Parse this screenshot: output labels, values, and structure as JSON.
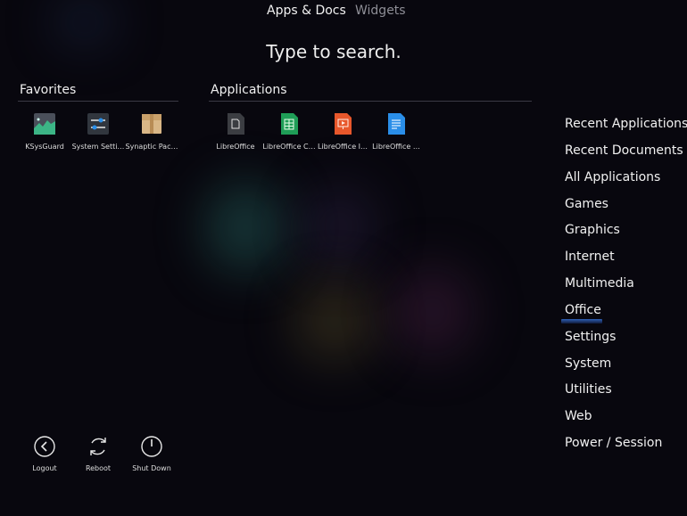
{
  "tabs": [
    {
      "label": "Apps & Docs",
      "active": true
    },
    {
      "label": "Widgets",
      "active": false
    }
  ],
  "search": {
    "hint": "Type to search."
  },
  "favorites": {
    "title": "Favorites",
    "items": [
      {
        "label": "KSysGuard",
        "icon": "ksysguard-icon"
      },
      {
        "label": "System Setti…",
        "icon": "system-settings-icon"
      },
      {
        "label": "Synaptic Pac…",
        "icon": "synaptic-package-icon"
      }
    ]
  },
  "applications": {
    "title": "Applications",
    "items": [
      {
        "label": "LibreOffice",
        "icon": "libreoffice-icon"
      },
      {
        "label": "LibreOffice C…",
        "icon": "libreoffice-calc-icon"
      },
      {
        "label": "LibreOffice I…",
        "icon": "libreoffice-impress-icon"
      },
      {
        "label": "LibreOffice …",
        "icon": "libreoffice-writer-icon"
      }
    ]
  },
  "categories": {
    "selected": "Office",
    "items": [
      "Recent Applications",
      "Recent Documents",
      "All Applications",
      "Games",
      "Graphics",
      "Internet",
      "Multimedia",
      "Office",
      "Settings",
      "System",
      "Utilities",
      "Web",
      "Power / Session"
    ]
  },
  "power": [
    {
      "label": "Logout",
      "icon": "logout-icon"
    },
    {
      "label": "Reboot",
      "icon": "reboot-icon"
    },
    {
      "label": "Shut Down",
      "icon": "shutdown-icon"
    }
  ],
  "colors": {
    "background": "#08070e",
    "selection_accent": "#2e5fb4",
    "calc_green": "#1f9e57",
    "impress_orange": "#e8572b",
    "writer_blue": "#2a8ee8"
  }
}
